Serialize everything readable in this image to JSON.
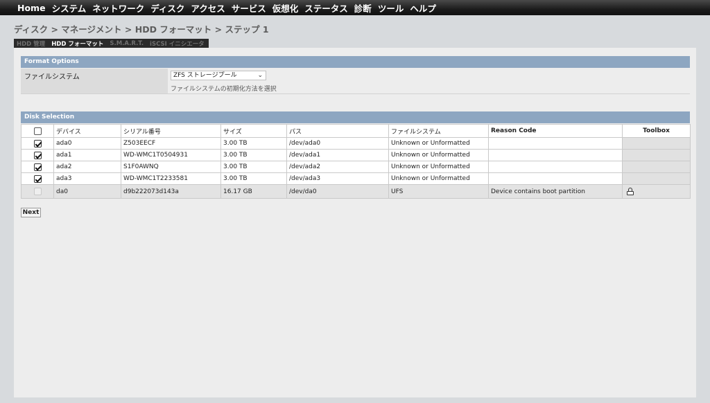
{
  "nav": {
    "items": [
      "Home",
      "システム",
      "ネットワーク",
      "ディスク",
      "アクセス",
      "サービス",
      "仮想化",
      "ステータス",
      "診断",
      "ツール",
      "ヘルプ"
    ]
  },
  "breadcrumb": "ディスク > マネージメント > HDD フォーマット > ステップ 1",
  "tabs": [
    {
      "label": "HDD 管理",
      "active": false
    },
    {
      "label": "HDD フォーマット",
      "active": true
    },
    {
      "label": "S.M.A.R.T.",
      "active": false
    },
    {
      "label": "iSCSI イニシエータ",
      "active": false
    }
  ],
  "format_options": {
    "header": "Format Options",
    "label": "ファイルシステム",
    "selected": "ZFS ストレージプール",
    "hint": "ファイルシステムの初期化方法を選択"
  },
  "disk_selection": {
    "header": "Disk Selection",
    "columns": [
      "デバイス",
      "シリアル番号",
      "サイズ",
      "パス",
      "ファイルシステム",
      "Reason Code",
      "Toolbox"
    ],
    "rows": [
      {
        "checked": true,
        "device": "ada0",
        "serial": "Z503EECF",
        "size": "3.00 TB",
        "path": "/dev/ada0",
        "fs": "Unknown or Unformatted",
        "reason": "",
        "disabled": false
      },
      {
        "checked": true,
        "device": "ada1",
        "serial": "WD-WMC1T0504931",
        "size": "3.00 TB",
        "path": "/dev/ada1",
        "fs": "Unknown or Unformatted",
        "reason": "",
        "disabled": false
      },
      {
        "checked": true,
        "device": "ada2",
        "serial": "S1F0AWNQ",
        "size": "3.00 TB",
        "path": "/dev/ada2",
        "fs": "Unknown or Unformatted",
        "reason": "",
        "disabled": false
      },
      {
        "checked": true,
        "device": "ada3",
        "serial": "WD-WMC1T2233581",
        "size": "3.00 TB",
        "path": "/dev/ada3",
        "fs": "Unknown or Unformatted",
        "reason": "",
        "disabled": false
      },
      {
        "checked": false,
        "device": "da0",
        "serial": "d9b222073d143a",
        "size": "16.17 GB",
        "path": "/dev/da0",
        "fs": "UFS",
        "reason": "Device contains boot partition",
        "disabled": true
      }
    ]
  },
  "next_label": "Next"
}
